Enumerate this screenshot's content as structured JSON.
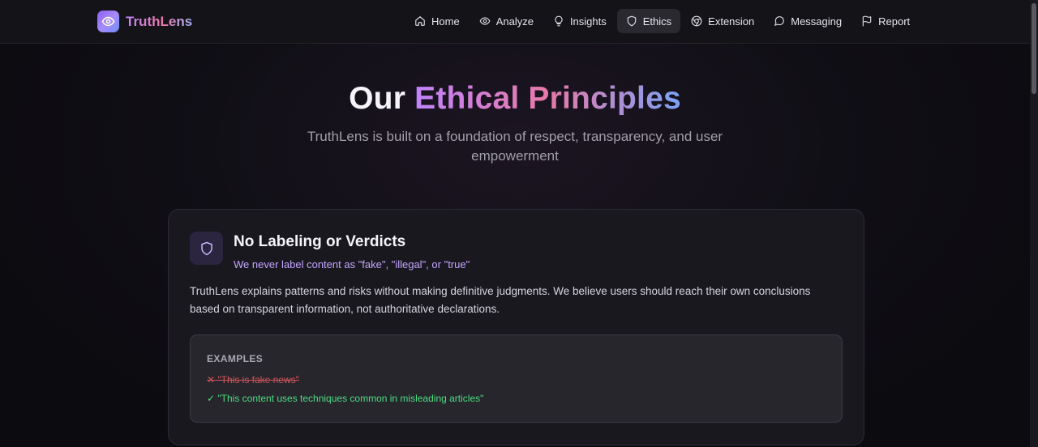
{
  "brand": {
    "name": "TruthLens",
    "logo_icon": "eye-icon"
  },
  "nav": {
    "items": [
      {
        "label": "Home",
        "icon": "home-icon"
      },
      {
        "label": "Analyze",
        "icon": "eye-icon"
      },
      {
        "label": "Insights",
        "icon": "lightbulb-icon"
      },
      {
        "label": "Ethics",
        "icon": "shield-icon",
        "active": true
      },
      {
        "label": "Extension",
        "icon": "chrome-icon"
      },
      {
        "label": "Messaging",
        "icon": "message-circle-icon"
      },
      {
        "label": "Report",
        "icon": "flag-icon"
      }
    ]
  },
  "hero": {
    "title_plain": "Our",
    "title_gradient": "Ethical Principles",
    "subtitle": "TruthLens is built on a foundation of respect, transparency, and user empowerment"
  },
  "principle": {
    "icon": "shield-icon",
    "title": "No Labeling or Verdicts",
    "subtitle": "We never label content as \"fake\", \"illegal\", or \"true\"",
    "body": "TruthLens explains patterns and risks without making definitive judgments. We believe users should reach their own conclusions based on transparent information, not authoritative declarations.",
    "examples": {
      "label": "EXAMPLES",
      "bad": "✕ \"This is fake news\"",
      "good": "✓ \"This content uses techniques common in misleading articles\""
    }
  },
  "colors": {
    "accent_purple": "#c084fc",
    "accent_pink": "#e879a9",
    "accent_blue": "#7aa2f7",
    "bad_red": "#d0565a",
    "good_green": "#4ade80"
  }
}
